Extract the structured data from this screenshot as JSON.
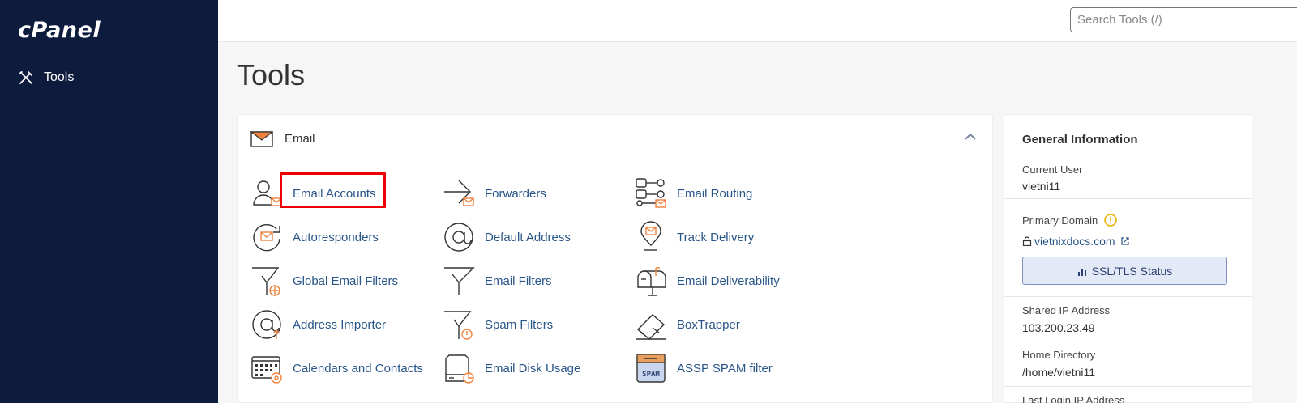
{
  "brand": {
    "logo": "cPanel"
  },
  "sidebar": {
    "items": [
      {
        "label": "Tools",
        "icon": "tools-icon"
      }
    ]
  },
  "header": {
    "search_placeholder": "Search Tools (/)"
  },
  "page": {
    "title": "Tools"
  },
  "email_section": {
    "title": "Email",
    "tools": [
      {
        "label": "Email Accounts",
        "icon": "email-accounts-icon"
      },
      {
        "label": "Forwarders",
        "icon": "forwarders-icon"
      },
      {
        "label": "Email Routing",
        "icon": "email-routing-icon"
      },
      {
        "label": "Autoresponders",
        "icon": "autoresponders-icon"
      },
      {
        "label": "Default Address",
        "icon": "default-address-icon"
      },
      {
        "label": "Track Delivery",
        "icon": "track-delivery-icon"
      },
      {
        "label": "Global Email Filters",
        "icon": "global-email-filters-icon"
      },
      {
        "label": "Email Filters",
        "icon": "email-filters-icon"
      },
      {
        "label": "Email Deliverability",
        "icon": "email-deliverability-icon"
      },
      {
        "label": "Address Importer",
        "icon": "address-importer-icon"
      },
      {
        "label": "Spam Filters",
        "icon": "spam-filters-icon"
      },
      {
        "label": "BoxTrapper",
        "icon": "boxtrapper-icon"
      },
      {
        "label": "Calendars and Contacts",
        "icon": "calendars-contacts-icon"
      },
      {
        "label": "Email Disk Usage",
        "icon": "email-disk-usage-icon"
      },
      {
        "label": "ASSP SPAM filter",
        "icon": "assp-spam-filter-icon"
      }
    ]
  },
  "general_info": {
    "title": "General Information",
    "current_user_label": "Current User",
    "current_user": "vietni11",
    "primary_domain_label": "Primary Domain",
    "primary_domain": "vietnixdocs.com",
    "ssl_button": "SSL/TLS Status",
    "shared_ip_label": "Shared IP Address",
    "shared_ip": "103.200.23.49",
    "home_dir_label": "Home Directory",
    "home_dir": "/home/vietni11",
    "last_login_label": "Last Login IP Address"
  },
  "colors": {
    "sidebar_bg": "#0d1b3d",
    "link": "#285588",
    "accent_orange": "#f0823c",
    "highlight": "#e00000"
  }
}
